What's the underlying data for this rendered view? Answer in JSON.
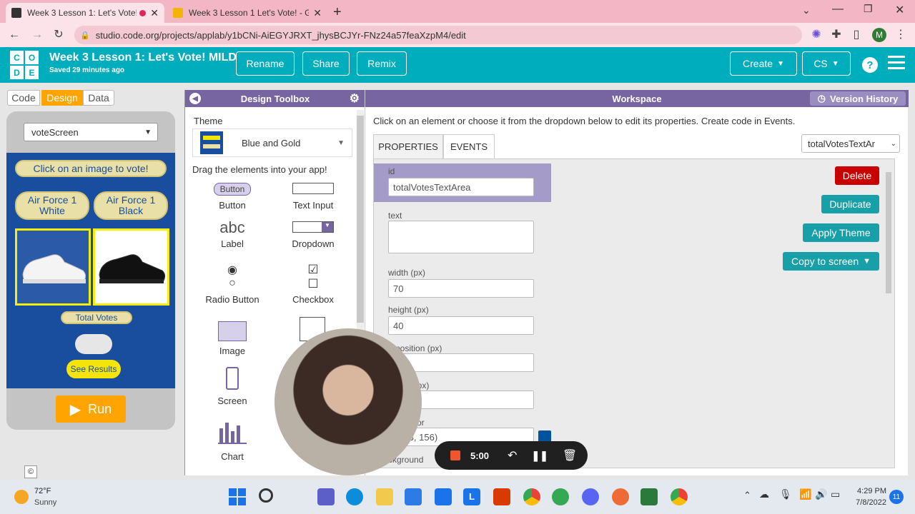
{
  "browser": {
    "tabs": [
      {
        "title": "Week 3 Lesson 1: Let's Vote!",
        "active": true
      },
      {
        "title": "Week 3 Lesson 1 Let's Vote! - Go",
        "active": false
      }
    ],
    "url": "studio.code.org/projects/applab/y1bCNi-AiEGYJRXT_jhysBCJYr-FNz24a57feaXzpM4/edit",
    "profile_initial": "M"
  },
  "header": {
    "logo_letters": [
      "C",
      "O",
      "D",
      "E"
    ],
    "project_title": "Week 3 Lesson 1: Let's Vote! MILD",
    "saved_text": "Saved 29 minutes ago",
    "rename": "Rename",
    "share": "Share",
    "remix": "Remix",
    "create": "Create",
    "language": "CS"
  },
  "modes": [
    "Code",
    "Design",
    "Data"
  ],
  "app": {
    "screen_select": "voteScreen",
    "prompt": "Click on an image to vote!",
    "option1": "Air Force 1 White",
    "option2": "Air Force 1 Black",
    "total_votes": "Total Votes",
    "see_results": "See Results",
    "run": "Run"
  },
  "toolbox": {
    "title": "Design Toolbox",
    "theme_label": "Theme",
    "theme_value": "Blue and Gold",
    "drag_hint": "Drag the elements into your app!",
    "button_sample": "Button",
    "items": [
      "Button",
      "Text Input",
      "Label",
      "Dropdown",
      "Radio Button",
      "Checkbox",
      "Image",
      "Screen",
      "Chart"
    ],
    "label_sample": "abc"
  },
  "workspace": {
    "title": "Workspace",
    "version_history": "Version History",
    "instructions": "Click on an element or choose it from the dropdown below to edit its properties. Create code in Events.",
    "tab_properties": "PROPERTIES",
    "tab_events": "EVENTS",
    "element_select": "totalVotesTextAr",
    "id_label": "id",
    "id_value": "totalVotesTextArea",
    "text_label": "text",
    "text_value": "",
    "width_label": "width (px)",
    "width_value": "70",
    "height_label": "height (px)",
    "height_value": "40",
    "x_label": "position (px)",
    "y_label": "on (px)",
    "color_label": "or",
    "color_value": "0, 83, 156)",
    "bg_label": "ckground",
    "delete": "Delete",
    "duplicate": "Duplicate",
    "apply_theme": "Apply Theme",
    "copy_to_screen": "Copy to screen"
  },
  "recorder": {
    "time": "5:00"
  },
  "taskbar": {
    "temp": "72°F",
    "weather": "Sunny",
    "time": "4:29 PM",
    "date": "7/8/2022",
    "notifications": "11"
  },
  "colors": {
    "header": "#00adbc",
    "accent_purple": "#7665a0",
    "delete_red": "#c80000",
    "teal_button": "#17a0a8",
    "run_orange": "#ffa400",
    "app_bg": "#194e9e"
  }
}
